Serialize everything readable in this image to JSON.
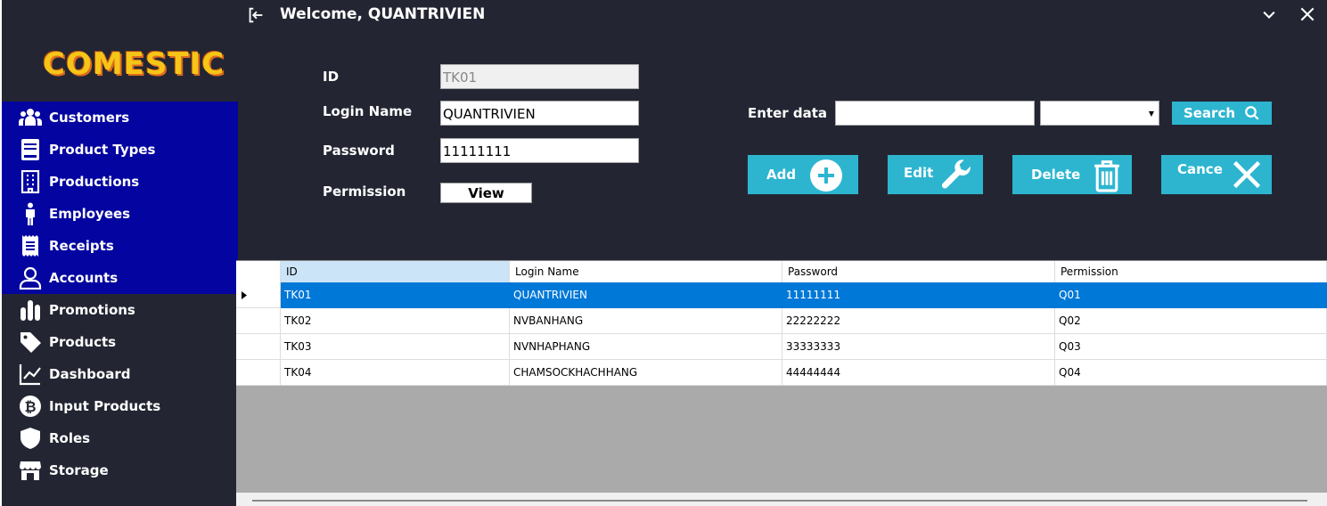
{
  "window": {
    "welcome": "Welcome, QUANTRIVIEN"
  },
  "logo": {
    "text": "COMESTIC"
  },
  "sidebar": {
    "items": [
      {
        "label": "Customers",
        "icon": "users-icon",
        "selected": true
      },
      {
        "label": "Product Types",
        "icon": "book-icon",
        "selected": true
      },
      {
        "label": "Productions",
        "icon": "building-icon",
        "selected": true
      },
      {
        "label": "Employees",
        "icon": "person-icon",
        "selected": true
      },
      {
        "label": "Receipts",
        "icon": "receipt-icon",
        "selected": true
      },
      {
        "label": "Accounts",
        "icon": "user-outline-icon",
        "selected": true
      },
      {
        "label": "Promotions",
        "icon": "bar-chart-icon",
        "selected": false
      },
      {
        "label": "Products",
        "icon": "tag-icon",
        "selected": false
      },
      {
        "label": "Dashboard",
        "icon": "line-chart-icon",
        "selected": false
      },
      {
        "label": "Input Products",
        "icon": "bitcoin-icon",
        "selected": false
      },
      {
        "label": "Roles",
        "icon": "shield-icon",
        "selected": false
      },
      {
        "label": "Storage",
        "icon": "store-icon",
        "selected": false
      }
    ]
  },
  "form": {
    "id_label": "ID",
    "id_value": "TK01",
    "login_label": "Login Name",
    "login_value": "QUANTRIVIEN",
    "password_label": "Password",
    "password_value": "11111111",
    "permission_label": "Permission",
    "view_button": "View"
  },
  "search": {
    "label": "Enter data",
    "value": "",
    "select_value": "",
    "button": "Search"
  },
  "actions": {
    "add": "Add",
    "edit": "Edit",
    "delete": "Delete",
    "cancel": "Cance"
  },
  "colors": {
    "accent": "#2db5d0",
    "sidebar_selected": "#0404a0",
    "row_selected": "#0078d7",
    "background": "#232632"
  },
  "grid": {
    "columns": [
      "ID",
      "Login Name",
      "Password",
      "Permission"
    ],
    "rows": [
      [
        "TK01",
        "QUANTRIVIEN",
        "11111111",
        "Q01"
      ],
      [
        "TK02",
        "NVBANHANG",
        "22222222",
        "Q02"
      ],
      [
        "TK03",
        "NVNHAPHANG",
        "33333333",
        "Q03"
      ],
      [
        "TK04",
        "CHAMSOCKHACHHANG",
        "44444444",
        "Q04"
      ]
    ],
    "selected_row": 0
  }
}
